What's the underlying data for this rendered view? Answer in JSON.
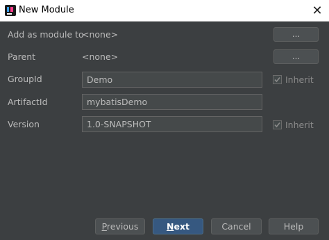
{
  "window": {
    "title": "New Module",
    "icon": "intellij-idea-icon",
    "close_glyph": "✕"
  },
  "form": {
    "module_parent": {
      "label": "Add as module to",
      "value": "<none>",
      "button": "..."
    },
    "parent": {
      "label": "Parent",
      "value": "<none>",
      "button": "..."
    },
    "group_id": {
      "label": "GroupId",
      "value": "Demo",
      "inherit_label": "Inherit",
      "inherit_checked": true
    },
    "artifact_id": {
      "label": "ArtifactId",
      "value": "mybatisDemo"
    },
    "version": {
      "label": "Version",
      "value": "1.0-SNAPSHOT",
      "inherit_label": "Inherit",
      "inherit_checked": true
    }
  },
  "buttons": {
    "previous": {
      "mnemonic": "P",
      "rest": "revious"
    },
    "next": {
      "mnemonic": "N",
      "rest": "ext"
    },
    "cancel": "Cancel",
    "help": "Help"
  },
  "colors": {
    "background": "#3c3f41",
    "primary_button": "#365880",
    "text": "#bbbbbb"
  }
}
